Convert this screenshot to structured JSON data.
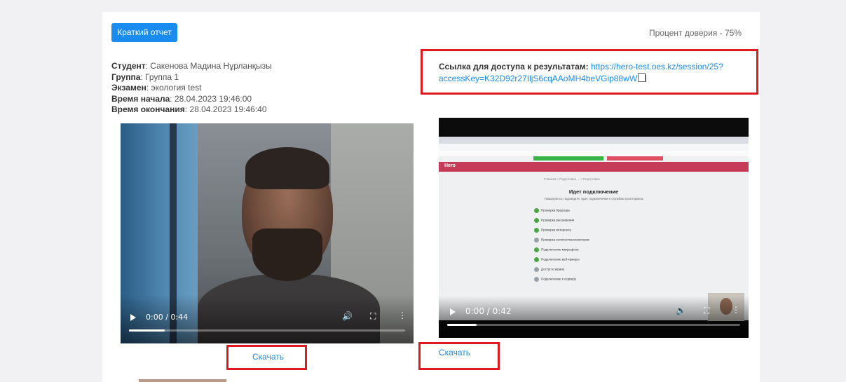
{
  "header": {
    "report_button": "Краткий отчет",
    "trust_label": "Процент доверия - 75%"
  },
  "student_info": [
    {
      "label": "Студент",
      "value": ": Сакенова Мадина Нұрланқызы"
    },
    {
      "label": "Группа",
      "value": ": Группа 1"
    },
    {
      "label": "Экзамен",
      "value": ": экология test"
    },
    {
      "label": "Время начала",
      "value": ": 28.04.2023 19:46:00"
    },
    {
      "label": "Время окончания",
      "value": ": 28.04.2023 19:46:40"
    }
  ],
  "access_link": {
    "label": "Ссылка для доступа к результатам:",
    "url_line1": "https://hero-test.oes.kz/session/25?",
    "url_line2": "accessKey=K32D92r27IljS6cqAAoMH4beVGip88wW"
  },
  "video_webcam": {
    "time": "0:00 / 0:44",
    "progress": 0.13,
    "download_label": "Скачать"
  },
  "video_screen": {
    "time": "0:00 / 0:42",
    "progress": 0.1,
    "download_label": "Скачать",
    "screen_logo": "Hero",
    "screen_crumb": "Главная > Подготовка ... > Подготовка",
    "screen_title": "Идет подключение",
    "screen_subtitle": "Пожалуйста, подождите, идет подключение к службам прокторинга",
    "screen_items": [
      "Проверка браузера",
      "Проверка расширения",
      "Проверка интернета",
      "Проверка количества мониторов",
      "Подключение микрофона",
      "Подключение веб-камеры",
      "Доступ к экрану",
      "Подключение к серверу"
    ]
  }
}
